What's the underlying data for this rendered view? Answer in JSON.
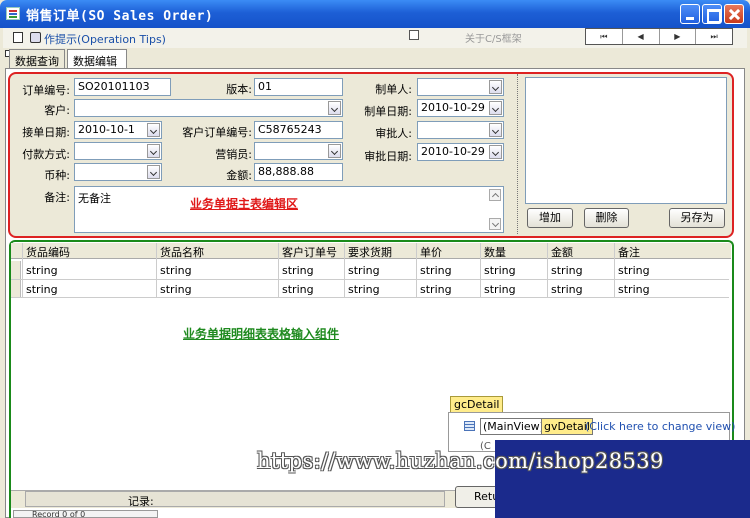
{
  "window": {
    "title": "销售订单(SO Sales Order)"
  },
  "toolbar": {
    "tips": "作提示(Operation Tips)",
    "about": "关于C/S框架",
    "nav": [
      "⏮",
      "◀",
      "▶",
      "⏭"
    ]
  },
  "tabs": [
    {
      "label": "数据查询"
    },
    {
      "label": "数据编辑"
    }
  ],
  "master": {
    "caption": "业务单据主表编辑区",
    "order_no": {
      "label": "订单编号:",
      "value": "SO20101103"
    },
    "version": {
      "label": "版本:",
      "value": "01"
    },
    "creator": {
      "label": "制单人:",
      "value": ""
    },
    "customer": {
      "label": "客户:",
      "value": ""
    },
    "create_date": {
      "label": "制单日期:",
      "value": "2010-10-29"
    },
    "receive_date": {
      "label": "接单日期:",
      "value": "2010-10-1"
    },
    "customer_order_no": {
      "label": "客户订单编号:",
      "value": "C58765243"
    },
    "approver": {
      "label": "审批人:",
      "value": ""
    },
    "payment": {
      "label": "付款方式:",
      "value": ""
    },
    "salesperson": {
      "label": "营销员:",
      "value": ""
    },
    "approve_date": {
      "label": "审批日期:",
      "value": "2010-10-29"
    },
    "currency": {
      "label": "币种:",
      "value": ""
    },
    "amount": {
      "label": "金额:",
      "value": "88,888.88"
    },
    "notes": {
      "label": "备注:",
      "value": "无备注"
    },
    "buttons": {
      "add": "增加",
      "delete": "删除",
      "save_as": "另存为"
    }
  },
  "detail": {
    "caption": "业务单据明细表表格输入组件",
    "columns": [
      "货品编码",
      "货品名称",
      "客户订单号",
      "要求货期",
      "单价",
      "数量",
      "金额",
      "备注"
    ],
    "rows": [
      [
        "string",
        "string",
        "string",
        "string",
        "string",
        "string",
        "string",
        "string"
      ],
      [
        "string",
        "string",
        "string",
        "string",
        "string",
        "string",
        "string",
        "string"
      ]
    ],
    "designer": {
      "tag": "gcDetail",
      "main_view": "(MainView)",
      "grid_view": "gvDetail",
      "hint": "(Click here to change view)",
      "fragment": "(C"
    },
    "footer": {
      "record_label": "记录:",
      "return_button": "Retu"
    }
  },
  "pager": {
    "text": "Record 0 of 0"
  },
  "watermark": {
    "text": "https://www.huzhan.com/ishop28539"
  }
}
